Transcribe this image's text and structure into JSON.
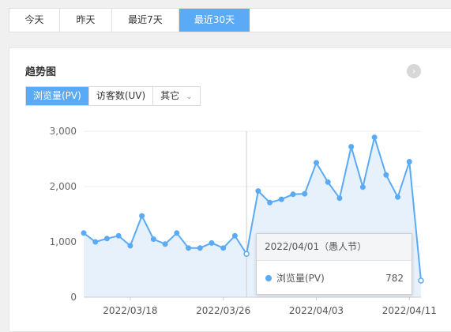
{
  "range_tabs": [
    "今天",
    "昨天",
    "最近7天",
    "最近30天"
  ],
  "card": {
    "title": "趋势图",
    "metric_tabs": [
      "浏览量(PV)",
      "访客数(UV)",
      "其它"
    ]
  },
  "tooltip": {
    "title": "2022/04/01（愚人节）",
    "series": "浏览量(PV)",
    "value": "782"
  },
  "colors": {
    "accent": "#5aaaf5",
    "area": "#e6f1fc",
    "grid": "#ececec"
  },
  "chart_data": {
    "type": "area",
    "series": [
      {
        "name": "浏览量(PV)",
        "values": [
          1160,
          1000,
          1060,
          1110,
          930,
          1470,
          1050,
          960,
          1160,
          890,
          890,
          980,
          890,
          1110,
          782,
          1920,
          1710,
          1770,
          1860,
          1870,
          2430,
          2080,
          1790,
          2720,
          1990,
          2890,
          2210,
          1810,
          2450,
          300
        ]
      }
    ],
    "y_ticks": [
      "0",
      "1,000",
      "2,000",
      "3,000"
    ],
    "ylim": [
      0,
      3000
    ],
    "x_tick_labels": [
      "2022/03/18",
      "2022/03/26",
      "2022/04/03",
      "2022/04/11"
    ],
    "x_tick_index": [
      4,
      12,
      20,
      28
    ],
    "highlight_index": 14,
    "grid": true
  }
}
